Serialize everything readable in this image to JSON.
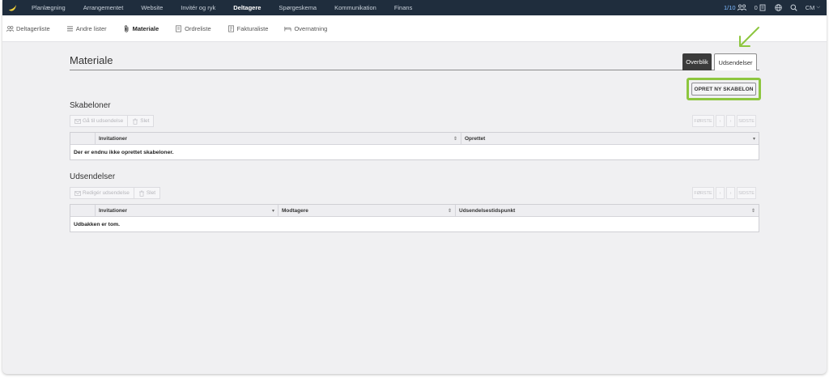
{
  "topnav": {
    "items": [
      "Planlægning",
      "Arrangementet",
      "Website",
      "Invitér og ryk",
      "Deltagere",
      "Spørgeskema",
      "Kommunikation",
      "Finans"
    ],
    "active_index": 4,
    "count": "1/10",
    "badge": "0",
    "user": "CM"
  },
  "subnav": {
    "items": [
      "Deltagerliste",
      "Andre lister",
      "Materiale",
      "Ordreliste",
      "Fakturaliste",
      "Overnatning"
    ],
    "active_index": 2
  },
  "page": {
    "title": "Materiale",
    "tab_overview": "Overblik",
    "tab_udsendelser": "Udsendelser",
    "create_button": "OPRET NY SKABELON"
  },
  "skabeloner": {
    "title": "Skabeloner",
    "btn_goto": "Gå til udsendelse",
    "btn_delete": "Slet",
    "columns": [
      "Invitationer",
      "Oprettet"
    ],
    "empty": "Der er endnu ikke oprettet skabeloner."
  },
  "udsendelser": {
    "title": "Udsendelser",
    "btn_edit": "Redigér udsendelse",
    "btn_delete": "Slet",
    "columns": [
      "Invitationer",
      "Modtagere",
      "Udsendelsestidspunkt"
    ],
    "empty": "Udbakken er tom."
  },
  "pager": {
    "first": "FØRSTE",
    "prev": "‹",
    "next": "›",
    "last": "SIDSTE"
  },
  "colors": {
    "nav_bg": "#1f2d3d",
    "highlight": "#8dc63f",
    "tab_dark": "#3b3b3b"
  }
}
